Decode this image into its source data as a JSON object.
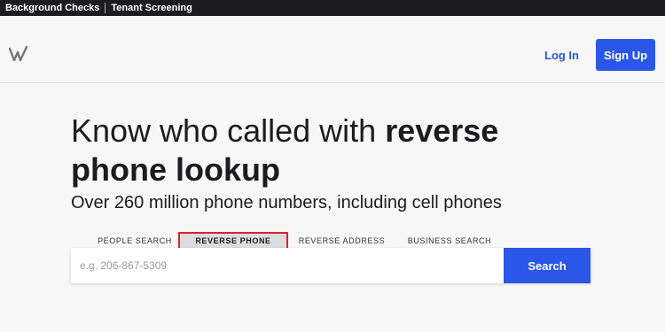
{
  "topbar": {
    "links": [
      "Background Checks",
      "Tenant Screening"
    ]
  },
  "header": {
    "logo_icon": "w-logo-icon",
    "login_label": "Log In",
    "signup_label": "Sign Up"
  },
  "hero": {
    "headline_normal": "Know who called with ",
    "headline_bold_1": "reverse",
    "headline_bold_2": "phone lookup",
    "subtitle": "Over 260 million phone numbers, including cell phones"
  },
  "tabs": [
    {
      "label": "PEOPLE SEARCH",
      "active": false
    },
    {
      "label": "REVERSE PHONE",
      "active": true
    },
    {
      "label": "REVERSE ADDRESS",
      "active": false
    },
    {
      "label": "BUSINESS SEARCH",
      "active": false
    }
  ],
  "search": {
    "placeholder": "e.g. 206-867-5309",
    "value": "",
    "button_label": "Search"
  },
  "colors": {
    "accent": "#2a57e8",
    "topbar_bg": "#1c1c1e",
    "active_tab_outline": "#e0202a"
  }
}
